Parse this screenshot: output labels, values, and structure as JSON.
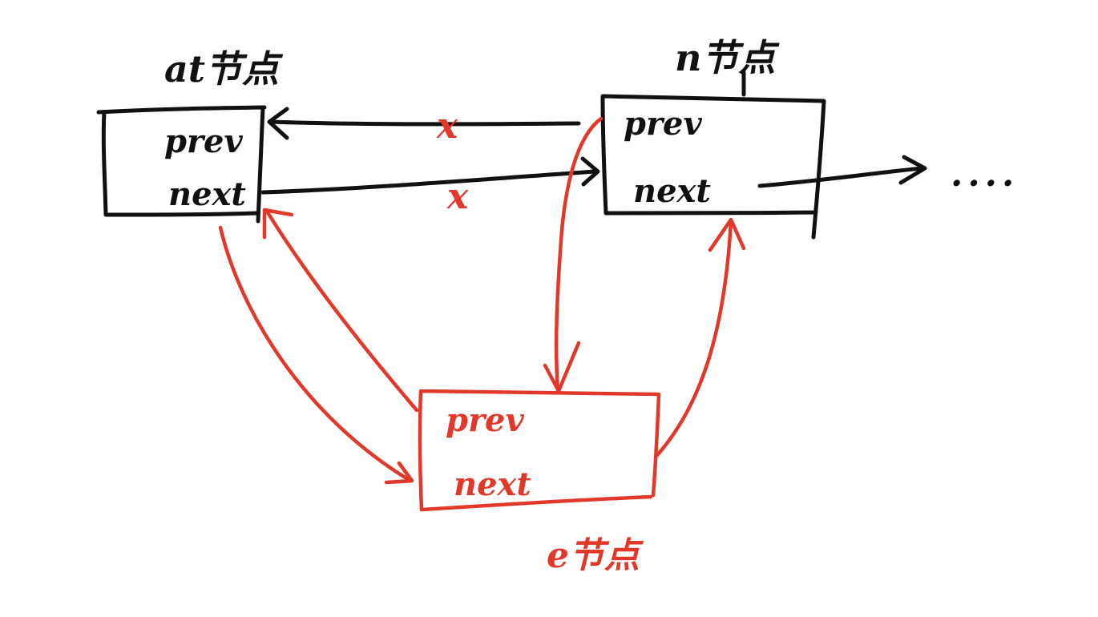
{
  "nodes": {
    "at": {
      "title": "at节点",
      "prev_label": "prev",
      "next_label": "next"
    },
    "n": {
      "title": "n节点",
      "prev_label": "prev",
      "next_label": "next"
    },
    "e": {
      "title": "e节点",
      "prev_label": "prev",
      "next_label": "next"
    }
  },
  "removed_mark": "x",
  "continuation": "....",
  "colors": {
    "existing": "#111111",
    "new_link": "#e2382a"
  }
}
